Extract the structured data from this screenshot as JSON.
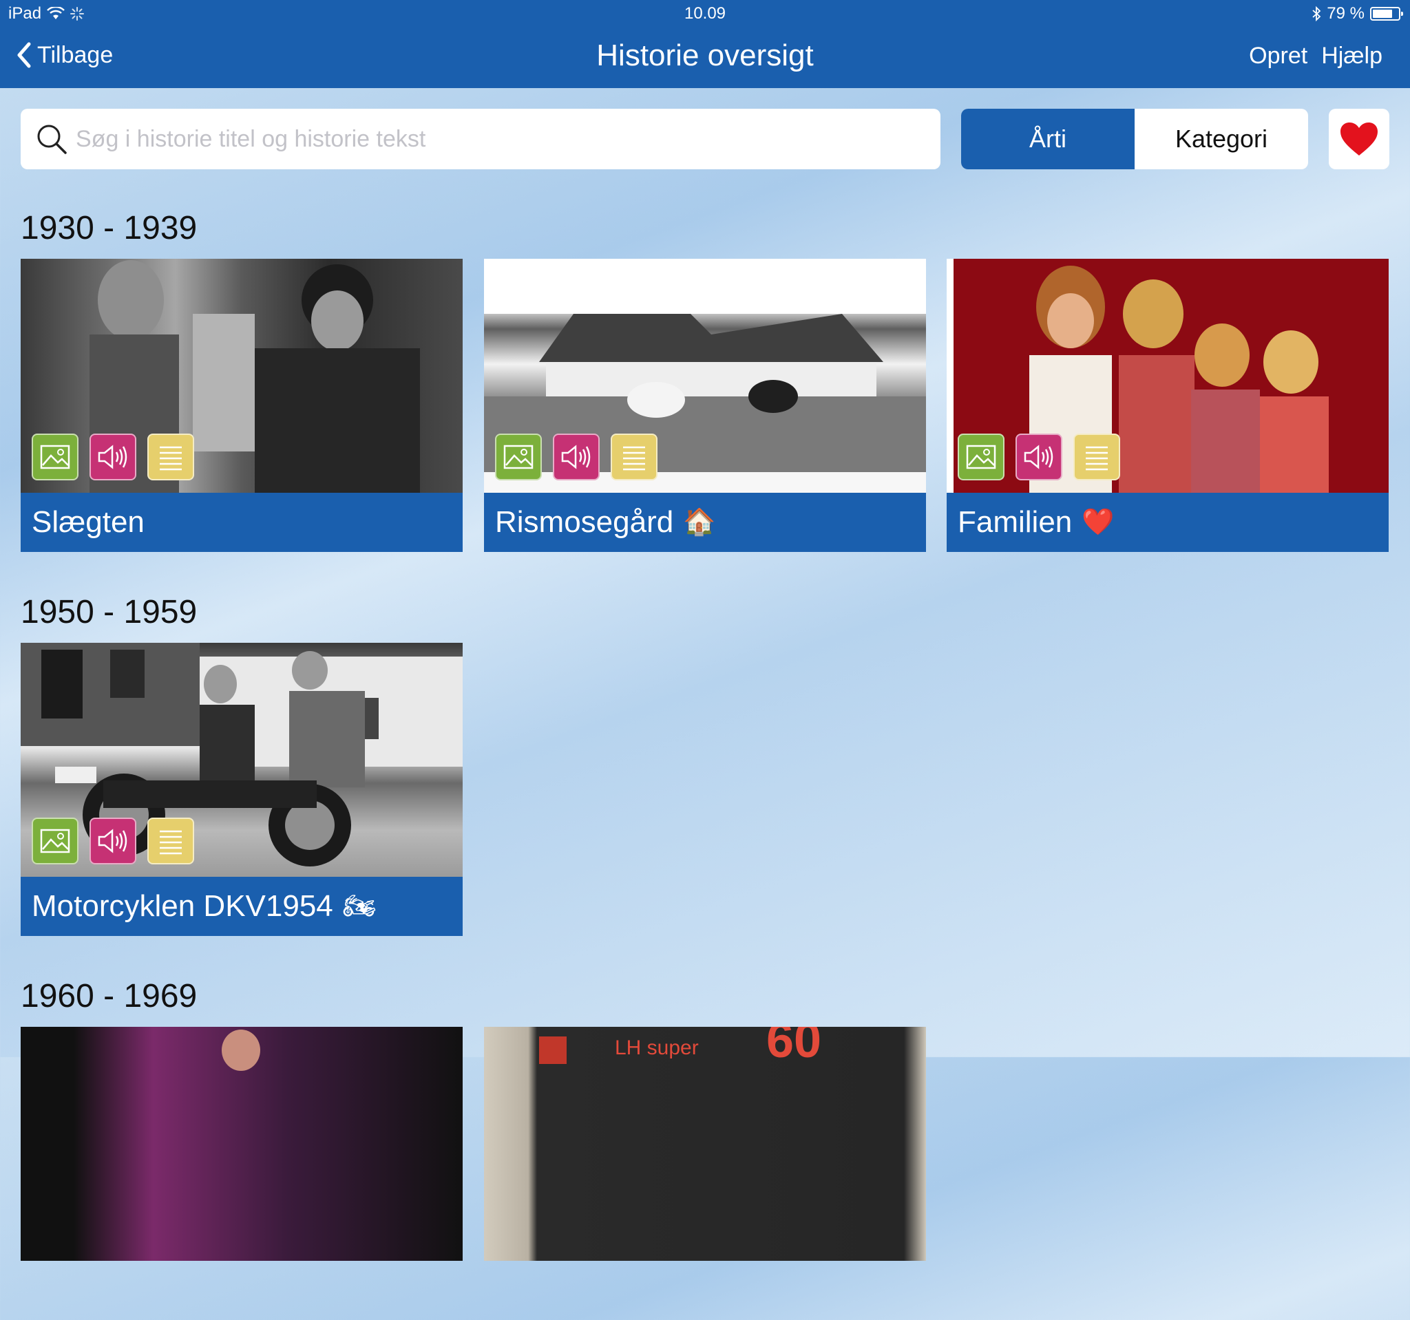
{
  "status_bar": {
    "device": "iPad",
    "time": "10.09",
    "battery": "79 %",
    "battery_level": 0.79
  },
  "nav": {
    "back_label": "Tilbage",
    "title": "Historie oversigt",
    "create_label": "Opret",
    "help_label": "Hjælp"
  },
  "search": {
    "placeholder": "Søg i historie titel og historie tekst",
    "value": ""
  },
  "segment": {
    "options": [
      "Årti",
      "Kategori"
    ],
    "selected": "Årti"
  },
  "favorites": {
    "icon": "heart-icon",
    "color": "#e3121d"
  },
  "colors": {
    "brand_blue": "#1a5fae",
    "badge_image": "#7cb03b",
    "badge_sound": "#c63174",
    "badge_text": "#e6cf6c"
  },
  "sections": [
    {
      "title": "1930 - 1939",
      "cards": [
        {
          "title": "Slægten",
          "emoji": ""
        },
        {
          "title": "Rismosegård",
          "emoji": "🏠"
        },
        {
          "title": "Familien",
          "emoji": "❤️"
        }
      ]
    },
    {
      "title": "1950 - 1959",
      "cards": [
        {
          "title": "Motorcyklen DKV1954",
          "emoji": "🏍"
        }
      ]
    },
    {
      "title": "1960 - 1969",
      "cards": [
        {
          "title": "",
          "emoji": ""
        },
        {
          "title": "",
          "emoji": "",
          "photo_text": "LH super",
          "photo_number": "60"
        }
      ]
    }
  ]
}
